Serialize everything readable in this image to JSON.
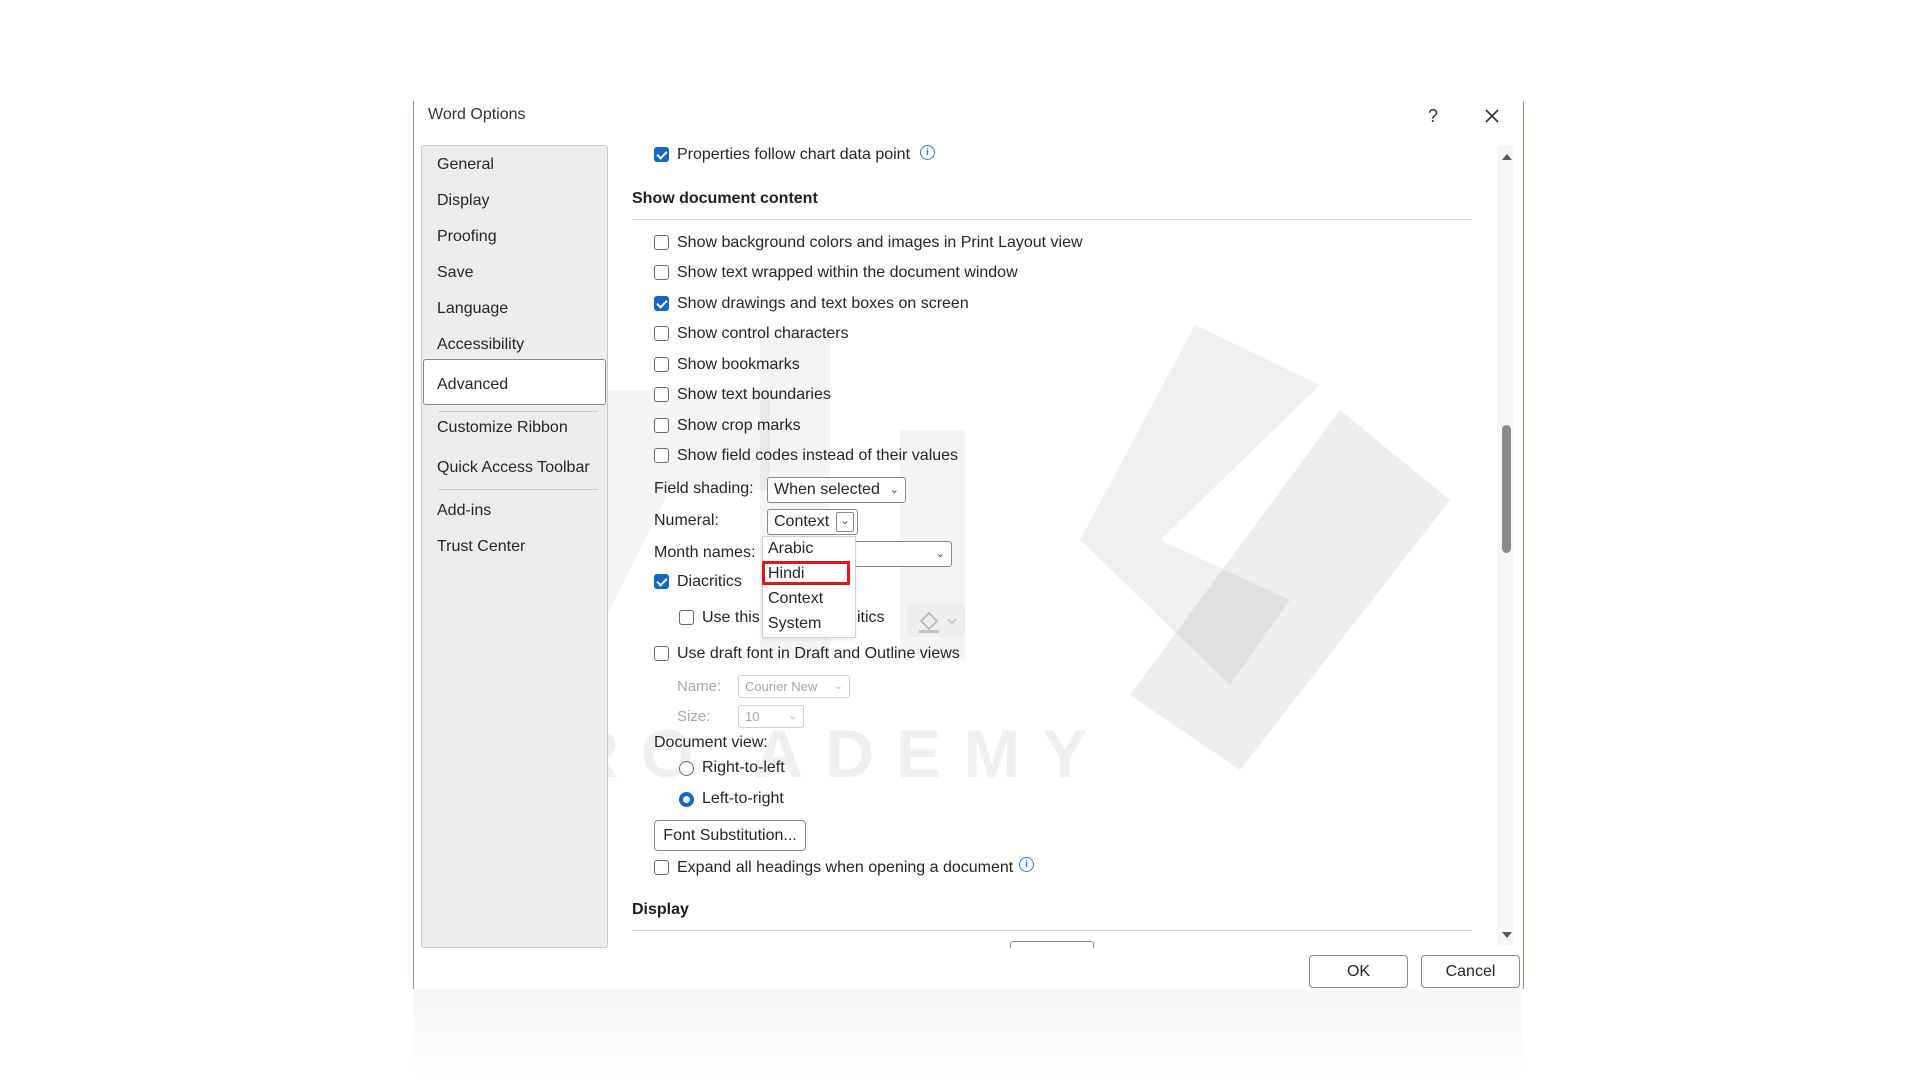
{
  "dialog": {
    "title": "Word Options",
    "help_label": "?"
  },
  "nav": {
    "items": [
      {
        "label": "General"
      },
      {
        "label": "Display"
      },
      {
        "label": "Proofing"
      },
      {
        "label": "Save"
      },
      {
        "label": "Language"
      },
      {
        "label": "Accessibility"
      },
      {
        "label": "Advanced",
        "selected": true
      },
      {
        "label": "Customize Ribbon"
      },
      {
        "label": "Quick Access Toolbar"
      },
      {
        "label": "Add-ins"
      },
      {
        "label": "Trust Center"
      }
    ]
  },
  "content": {
    "top_option": {
      "label": "Properties follow chart data point",
      "checked": true
    },
    "section_show_document_content": "Show document content",
    "options": [
      {
        "label": "Show background colors and images in Print Layout view",
        "checked": false
      },
      {
        "label": "Show text wrapped within the document window",
        "checked": false
      },
      {
        "label": "Show drawings and text boxes on screen",
        "checked": true
      },
      {
        "label": "Show control characters",
        "checked": false
      },
      {
        "label": "Show bookmarks",
        "checked": false
      },
      {
        "label": "Show text boundaries",
        "checked": false
      },
      {
        "label": "Show crop marks",
        "checked": false
      },
      {
        "label": "Show field codes instead of their values",
        "checked": false
      }
    ],
    "field_shading": {
      "label": "Field shading:",
      "value": "When selected"
    },
    "numeral": {
      "label": "Numeral:",
      "value": "Context"
    },
    "month_names": {
      "label": "Month names:"
    },
    "diacritics": {
      "label": "Diacritics",
      "checked": true
    },
    "use_this_color": {
      "label_left": "Use this c",
      "label_right": "itics",
      "checked": false
    },
    "draft_font": {
      "label": "Use draft font in Draft and Outline views",
      "checked": false
    },
    "draft_name": {
      "label": "Name:",
      "value": "Courier New"
    },
    "draft_size": {
      "label": "Size:",
      "value": "10"
    },
    "document_view": {
      "label": "Document view:"
    },
    "rtl": {
      "label": "Right-to-left",
      "selected": false
    },
    "ltr": {
      "label": "Left-to-right",
      "selected": true
    },
    "font_substitution_label": "Font Substitution...",
    "expand_headings": {
      "label": "Expand all headings when opening a document",
      "checked": false
    },
    "section_display": "Display"
  },
  "numeral_dropdown": {
    "options": [
      "Arabic",
      "Hindi",
      "Context",
      "System"
    ],
    "highlighted": "Hindi"
  },
  "footer": {
    "ok_label": "OK",
    "cancel_label": "Cancel"
  },
  "watermark": {
    "text": "ATRO   ADEMY"
  },
  "colors": {
    "accent": "#1467c4",
    "highlight_border": "#e0161c"
  }
}
